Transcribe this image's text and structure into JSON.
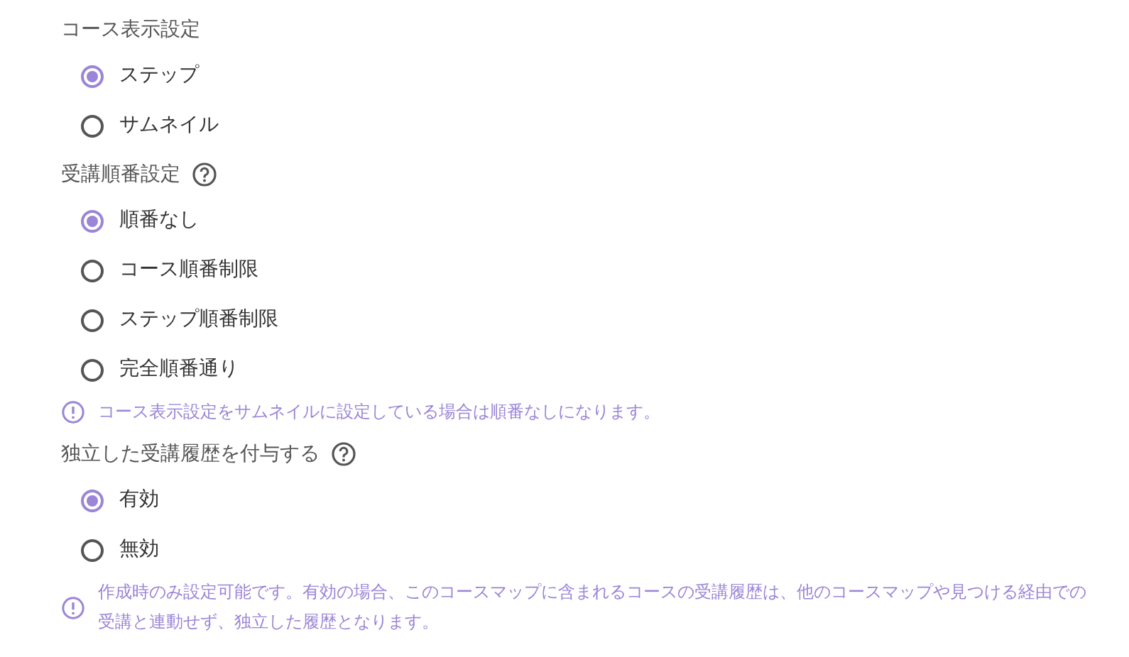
{
  "sections": [
    {
      "title": "コース表示設定",
      "help": false,
      "options": [
        {
          "label": "ステップ",
          "selected": true
        },
        {
          "label": "サムネイル",
          "selected": false
        }
      ]
    },
    {
      "title": "受講順番設定",
      "help": true,
      "options": [
        {
          "label": "順番なし",
          "selected": true
        },
        {
          "label": "コース順番制限",
          "selected": false
        },
        {
          "label": "ステップ順番制限",
          "selected": false
        },
        {
          "label": "完全順番通り",
          "selected": false
        }
      ],
      "note": "コース表示設定をサムネイルに設定している場合は順番なしになります。"
    },
    {
      "title": "独立した受講履歴を付与する",
      "help": true,
      "options": [
        {
          "label": "有効",
          "selected": true
        },
        {
          "label": "無効",
          "selected": false
        }
      ],
      "note": "作成時のみ設定可能です。有効の場合、このコースマップに含まれるコースの受講履歴は、他のコースマップや見つける経由での受講と連動せず、独立した履歴となります。"
    }
  ]
}
